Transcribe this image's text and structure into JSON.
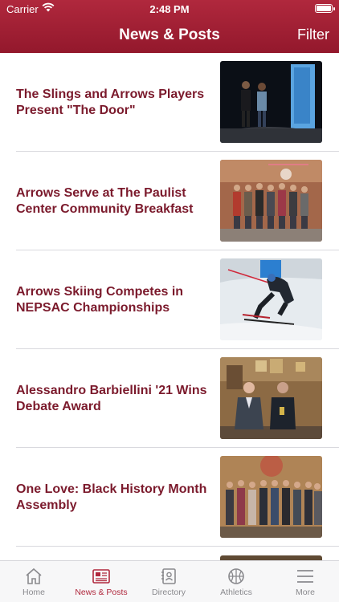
{
  "status": {
    "carrier": "Carrier",
    "time": "2:48 PM"
  },
  "nav": {
    "title": "News & Posts",
    "filter": "Filter"
  },
  "posts": [
    {
      "title": "The Slings and Arrows Players Present \"The Door\""
    },
    {
      "title": "Arrows Serve at The Paulist Center Community Breakfast"
    },
    {
      "title": "Arrows Skiing Competes in NEPSAC Championships"
    },
    {
      "title": "Alessandro Barbiellini '21 Wins Debate Award"
    },
    {
      "title": "One Love: Black History Month Assembly"
    }
  ],
  "tabs": [
    {
      "label": "Home",
      "icon": "home-icon"
    },
    {
      "label": "News & Posts",
      "icon": "newspaper-icon",
      "active": true
    },
    {
      "label": "Directory",
      "icon": "directory-icon"
    },
    {
      "label": "Athletics",
      "icon": "basketball-icon"
    },
    {
      "label": "More",
      "icon": "menu-icon"
    }
  ],
  "colors": {
    "brand": "#9e1f33",
    "title_text": "#7b1a2c",
    "tab_inactive": "#8a8a8e"
  }
}
